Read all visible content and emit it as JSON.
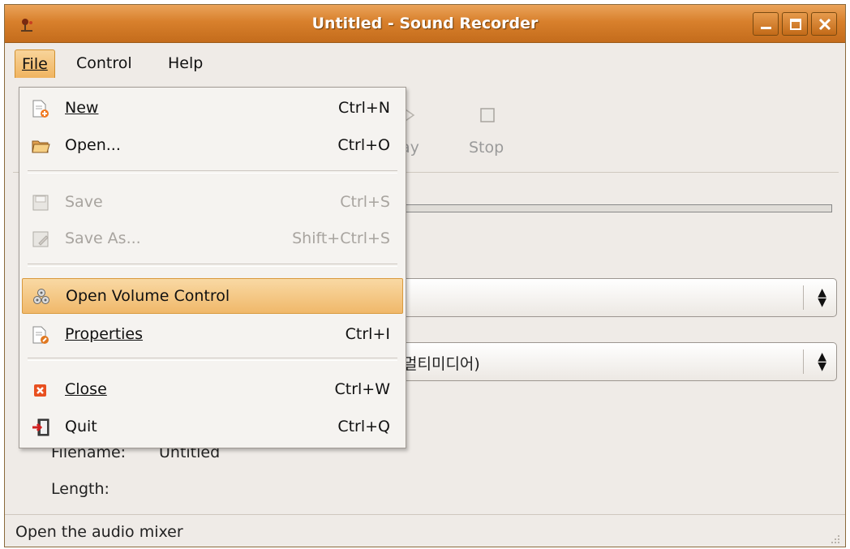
{
  "window": {
    "title": "Untitled - Sound Recorder"
  },
  "menubar": {
    "file": "File",
    "control": "Control",
    "help": "Help"
  },
  "toolbar": {
    "play_partial": "ay",
    "stop": "Stop"
  },
  "background": {
    "combo2_partial": "멀티미디어)",
    "filename_label": "Filename:",
    "filename_value": "Untitled",
    "length_label": "Length:"
  },
  "file_menu": {
    "items": [
      {
        "label": "New",
        "accel": "Ctrl+N",
        "icon": "new-file-icon",
        "enabled": true
      },
      {
        "label": "Open...",
        "accel": "Ctrl+O",
        "icon": "open-folder-icon",
        "enabled": true
      },
      {
        "label": "Save",
        "accel": "Ctrl+S",
        "icon": "save-icon",
        "enabled": false
      },
      {
        "label": "Save As...",
        "accel": "Shift+Ctrl+S",
        "icon": "save-as-icon",
        "enabled": false
      },
      {
        "label": "Open Volume Control",
        "accel": "",
        "icon": "volume-control-icon",
        "enabled": true,
        "highlighted": true
      },
      {
        "label": "Properties",
        "accel": "Ctrl+I",
        "icon": "properties-icon",
        "enabled": true
      },
      {
        "label": "Close",
        "accel": "Ctrl+W",
        "icon": "close-icon",
        "enabled": true
      },
      {
        "label": "Quit",
        "accel": "Ctrl+Q",
        "icon": "quit-icon",
        "enabled": true
      }
    ]
  },
  "statusbar": {
    "text": "Open the audio mixer"
  },
  "colors": {
    "titlebar": "#d8802c",
    "highlight": "#f0b86a",
    "window_bg": "#efebe7"
  }
}
